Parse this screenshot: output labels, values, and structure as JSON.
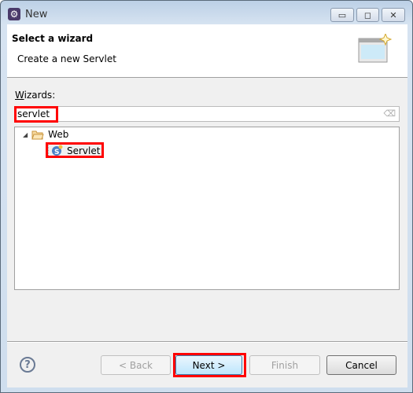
{
  "window": {
    "title": "New",
    "minimize": "▭",
    "maximize": "◻",
    "close": "✕"
  },
  "header": {
    "title": "Select a wizard",
    "subtitle": "Create a new Servlet"
  },
  "wizards": {
    "label": "Wizards:",
    "filter_value": "servlet"
  },
  "tree": {
    "items": [
      {
        "label": "Web",
        "expanded": true,
        "icon": "folder-icon"
      },
      {
        "label": "Servlet",
        "selected": true,
        "icon": "servlet-icon"
      }
    ]
  },
  "buttons": {
    "help": "?",
    "back": "< Back",
    "next": "Next >",
    "finish": "Finish",
    "cancel": "Cancel"
  },
  "colors": {
    "highlight": "#ff0000"
  }
}
